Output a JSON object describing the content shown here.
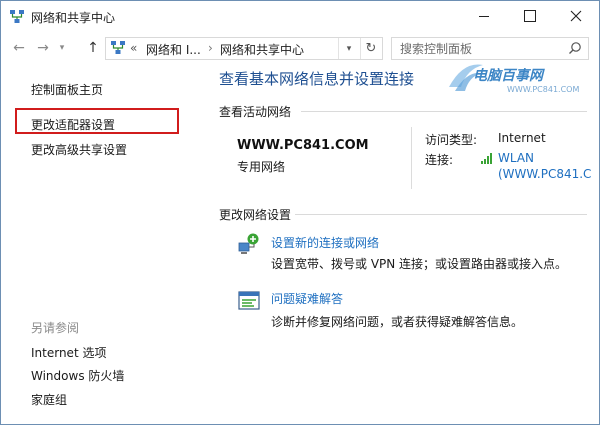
{
  "window": {
    "title": "网络和共享中心"
  },
  "address_bar": {
    "overflow": "«",
    "crumbs": [
      "网络和 I...",
      "网络和共享中心"
    ],
    "separator": "›"
  },
  "search": {
    "placeholder": "搜索控制面板"
  },
  "left_pane": {
    "links": [
      "控制面板主页",
      "更改适配器设置",
      "更改高级共享设置"
    ],
    "see_also_title": "另请参阅",
    "see_also": [
      "Internet 选项",
      "Windows 防火墙",
      "家庭组"
    ]
  },
  "main": {
    "title": "查看基本网络信息并设置连接",
    "watermark": {
      "name": "电脑百事网",
      "url": "WWW.PC841.COM"
    },
    "active_section": "查看活动网络",
    "network": {
      "name": "WWW.PC841.COM",
      "type": "专用网络",
      "access_label": "访问类型:",
      "access_value": "Internet",
      "connection_label": "连接:",
      "connection_value": "WLAN",
      "connection_value_2": "(WWW.PC841.C"
    },
    "change_section": "更改网络设置",
    "tasks": [
      {
        "title": "设置新的连接或网络",
        "desc": "设置宽带、拨号或 VPN 连接；或设置路由器或接入点。"
      },
      {
        "title": "问题疑难解答",
        "desc": "诊断并修复网络问题，或者获得疑难解答信息。"
      }
    ]
  },
  "colors": {
    "link": "#1e6fc0",
    "heading": "#1e4f91",
    "highlight": "#d11c1c"
  },
  "icons": [
    "network-center-icon",
    "back-icon",
    "forward-icon",
    "chevron-down-icon",
    "up-arrow-icon",
    "refresh-icon",
    "search-icon",
    "wifi-signal-icon",
    "new-connection-icon",
    "troubleshoot-icon",
    "minimize-icon",
    "maximize-icon",
    "close-icon"
  ]
}
